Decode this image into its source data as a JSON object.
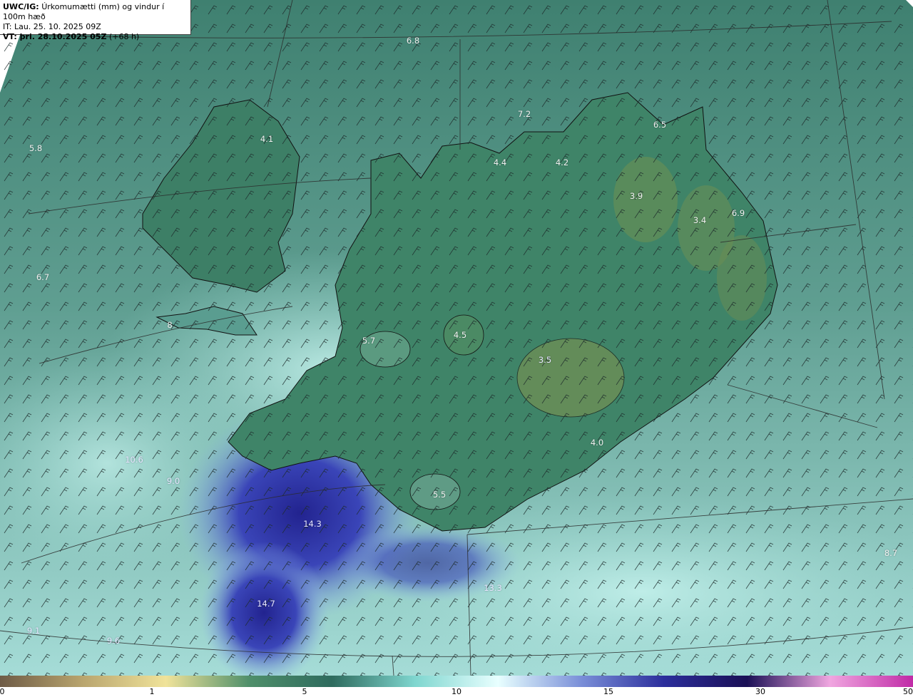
{
  "header": {
    "model": "UWC/IG:",
    "parameter": "Úrkomumætti (mm) og vindur í 100m hæð",
    "init_time": "IT: Lau. 25. 10. 2025 09Z",
    "valid_label": "VT: þri. 28.10.2025 05Z",
    "valid_offset": "(+68 h)"
  },
  "map_labels": [
    {
      "text": "6.8"
    },
    {
      "text": "7.2"
    },
    {
      "text": "6.5"
    },
    {
      "text": "5.8"
    },
    {
      "text": "4.1"
    },
    {
      "text": "4.4"
    },
    {
      "text": "4.2"
    },
    {
      "text": "3.9"
    },
    {
      "text": "3.4"
    },
    {
      "text": "6.9"
    },
    {
      "text": "6.7"
    },
    {
      "text": "8"
    },
    {
      "text": "5.7"
    },
    {
      "text": "4.5"
    },
    {
      "text": "3.5"
    },
    {
      "text": "4.0"
    },
    {
      "text": "10.6"
    },
    {
      "text": "9.0"
    },
    {
      "text": "5.5"
    },
    {
      "text": "14.3"
    },
    {
      "text": "13.3"
    },
    {
      "text": "14.7"
    },
    {
      "text": "9.1"
    },
    {
      "text": "9.6"
    },
    {
      "text": "8.7"
    }
  ],
  "colorbar": {
    "ticks": [
      "0",
      "1",
      "5",
      "10",
      "15",
      "30",
      "50"
    ],
    "colors": [
      "#6e5b46",
      "#b9a56e",
      "#f0e39a",
      "#4f8f6a",
      "#2e6b5e",
      "#7fd6cf",
      "#e8ffff",
      "#7a8fd8",
      "#2c2e9c",
      "#1a0f55",
      "#f0a6e0",
      "#c02aa6"
    ]
  },
  "colors": {
    "land_green": "#3c7d64",
    "sea_teal": "#4e8f80",
    "precip_blue": "#3b3fb3",
    "precip_light": "#c8f4f0"
  }
}
